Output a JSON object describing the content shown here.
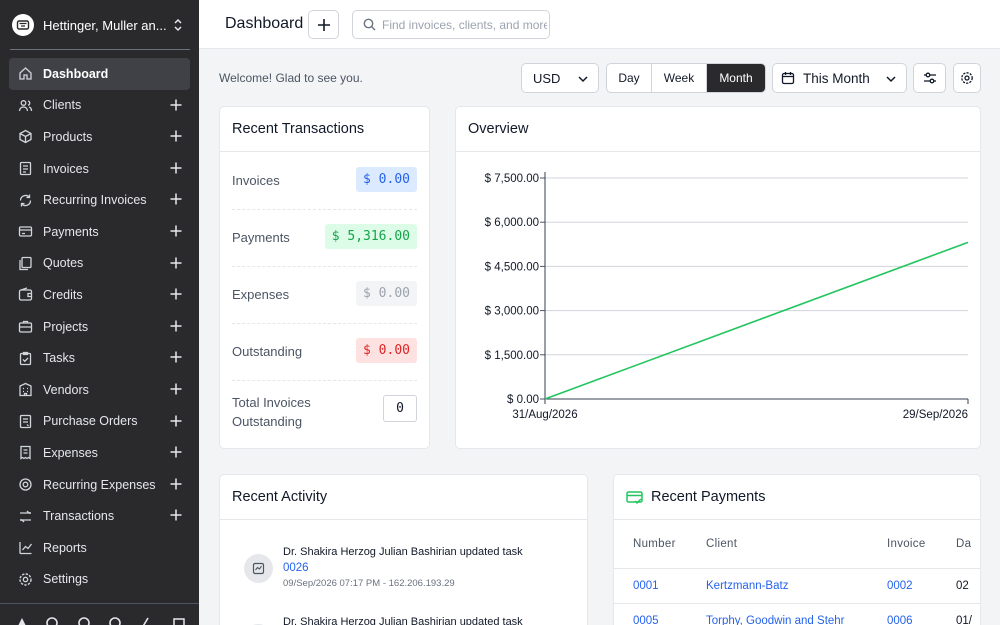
{
  "sidebar": {
    "company": "Hettinger, Muller an...",
    "items": [
      {
        "label": "Dashboard",
        "icon": "home-icon",
        "active": true,
        "plus": false
      },
      {
        "label": "Clients",
        "icon": "users-icon",
        "plus": true
      },
      {
        "label": "Products",
        "icon": "box-icon",
        "plus": true
      },
      {
        "label": "Invoices",
        "icon": "file-invoice-icon",
        "plus": true
      },
      {
        "label": "Recurring Invoices",
        "icon": "repeat-icon",
        "plus": true
      },
      {
        "label": "Payments",
        "icon": "credit-card-icon",
        "plus": true
      },
      {
        "label": "Quotes",
        "icon": "files-icon",
        "plus": true
      },
      {
        "label": "Credits",
        "icon": "wallet-icon",
        "plus": true
      },
      {
        "label": "Projects",
        "icon": "briefcase-icon",
        "plus": true
      },
      {
        "label": "Tasks",
        "icon": "clipboard-icon",
        "plus": true
      },
      {
        "label": "Vendors",
        "icon": "building-icon",
        "plus": true
      },
      {
        "label": "Purchase Orders",
        "icon": "purchase-icon",
        "plus": true
      },
      {
        "label": "Expenses",
        "icon": "receipt-icon",
        "plus": true
      },
      {
        "label": "Recurring Expenses",
        "icon": "recurring-expense-icon",
        "plus": true
      },
      {
        "label": "Transactions",
        "icon": "transactions-icon",
        "plus": true
      },
      {
        "label": "Reports",
        "icon": "chart-icon",
        "plus": false
      },
      {
        "label": "Settings",
        "icon": "gear-icon",
        "plus": false
      }
    ]
  },
  "topbar": {
    "title": "Dashboard",
    "search_placeholder": "Find invoices, clients, and more"
  },
  "toolbar": {
    "welcome": "Welcome! Glad to see you.",
    "currency": "USD",
    "periods": [
      "Day",
      "Week",
      "Month"
    ],
    "active_period": "Month",
    "range": "This Month"
  },
  "recent_transactions": {
    "title": "Recent Transactions",
    "rows": [
      {
        "label": "Invoices",
        "value": "$ 0.00",
        "style": "blue"
      },
      {
        "label": "Payments",
        "value": "$ 5,316.00",
        "style": "green"
      },
      {
        "label": "Expenses",
        "value": "$ 0.00",
        "style": "gray"
      },
      {
        "label": "Outstanding",
        "value": "$ 0.00",
        "style": "red"
      }
    ],
    "total_label": "Total Invoices Outstanding",
    "total_value": "0"
  },
  "overview": {
    "title": "Overview"
  },
  "chart_data": {
    "type": "line",
    "x": [
      "31/Aug/2026",
      "29/Sep/2026"
    ],
    "series": [
      {
        "values": [
          0,
          5316
        ],
        "color": "#22c55e"
      }
    ],
    "y_ticks": [
      "$ 0.00",
      "$ 1,500.00",
      "$ 3,000.00",
      "$ 4,500.00",
      "$ 6,000.00",
      "$ 7,500.00"
    ],
    "ylim": [
      0,
      7500
    ],
    "grid": true
  },
  "recent_activity": {
    "title": "Recent Activity",
    "items": [
      {
        "text": "Dr. Shakira Herzog Julian Bashirian updated task",
        "link": "0026",
        "meta": "09/Sep/2026 07:17 PM - 162.206.193.29"
      },
      {
        "text": "Dr. Shakira Herzog Julian Bashirian updated task",
        "link": "",
        "meta": ""
      }
    ]
  },
  "recent_payments": {
    "title": "Recent Payments",
    "columns": [
      "Number",
      "Client",
      "Invoice",
      "Da"
    ],
    "rows": [
      [
        "0001",
        "Kertzmann-Batz",
        "0002",
        "02"
      ],
      [
        "0005",
        "Torphy, Goodwin and Stehr",
        "0006",
        "01/"
      ]
    ]
  }
}
